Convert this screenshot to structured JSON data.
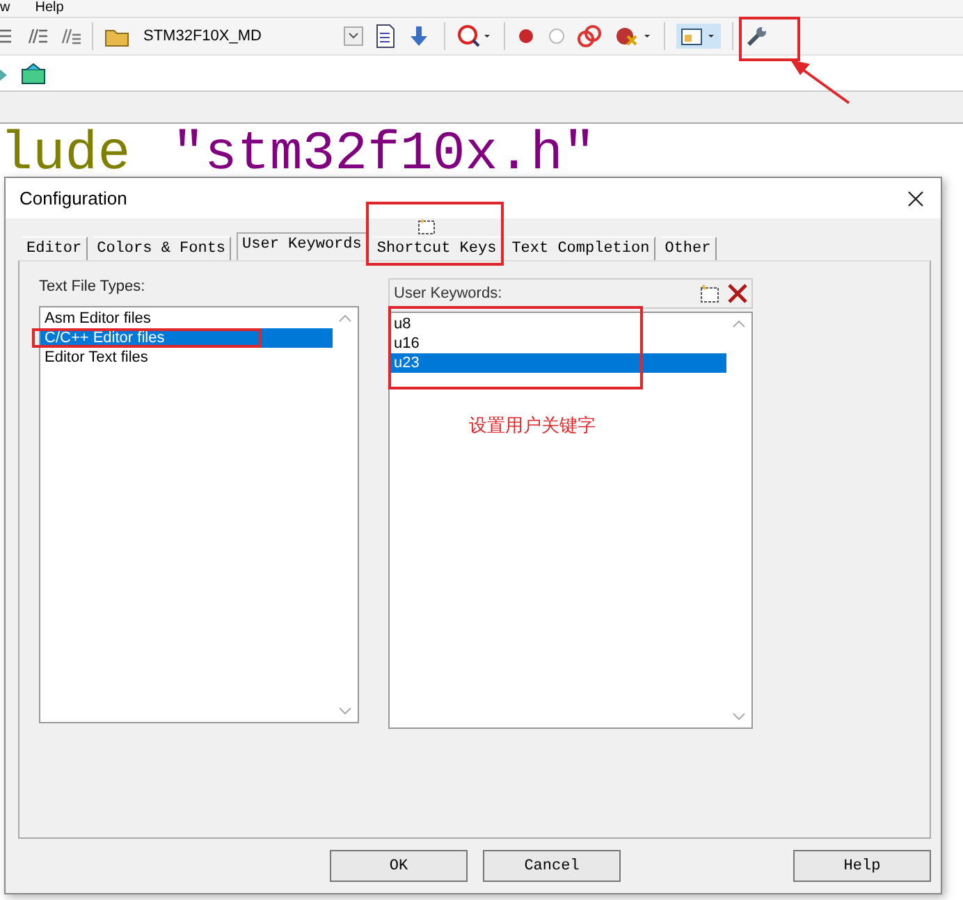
{
  "menu": [
    {
      "label": "w"
    },
    {
      "label": "Help"
    }
  ],
  "toolbar": {
    "target": "STM32F10X_MD"
  },
  "editor": {
    "tokens": [
      {
        "kind": "keyword",
        "text": "lude"
      },
      {
        "kind": "string",
        "text": "\"stm32f10x.h\""
      }
    ]
  },
  "dialog": {
    "title": "Configuration",
    "tabs": [
      {
        "label": "Editor",
        "selected": false
      },
      {
        "label": "Colors & Fonts",
        "selected": false
      },
      {
        "label": "User Keywords",
        "selected": true
      },
      {
        "label": "Shortcut Keys",
        "selected": false
      },
      {
        "label": "Text Completion",
        "selected": false
      },
      {
        "label": "Other",
        "selected": false
      }
    ],
    "file_types": {
      "label": "Text File Types:",
      "items": [
        {
          "label": "Asm Editor files",
          "selected": false
        },
        {
          "label": "C/C++ Editor files",
          "selected": true
        },
        {
          "label": "Editor Text files",
          "selected": false
        }
      ]
    },
    "keywords": {
      "label": "User Keywords:",
      "items": [
        {
          "label": "u8",
          "selected": false
        },
        {
          "label": "u16",
          "selected": false
        },
        {
          "label": "u23",
          "selected": true
        }
      ]
    },
    "buttons": [
      "OK",
      "Cancel",
      "Help"
    ]
  },
  "annotation": {
    "text": "设置用户关键字"
  }
}
